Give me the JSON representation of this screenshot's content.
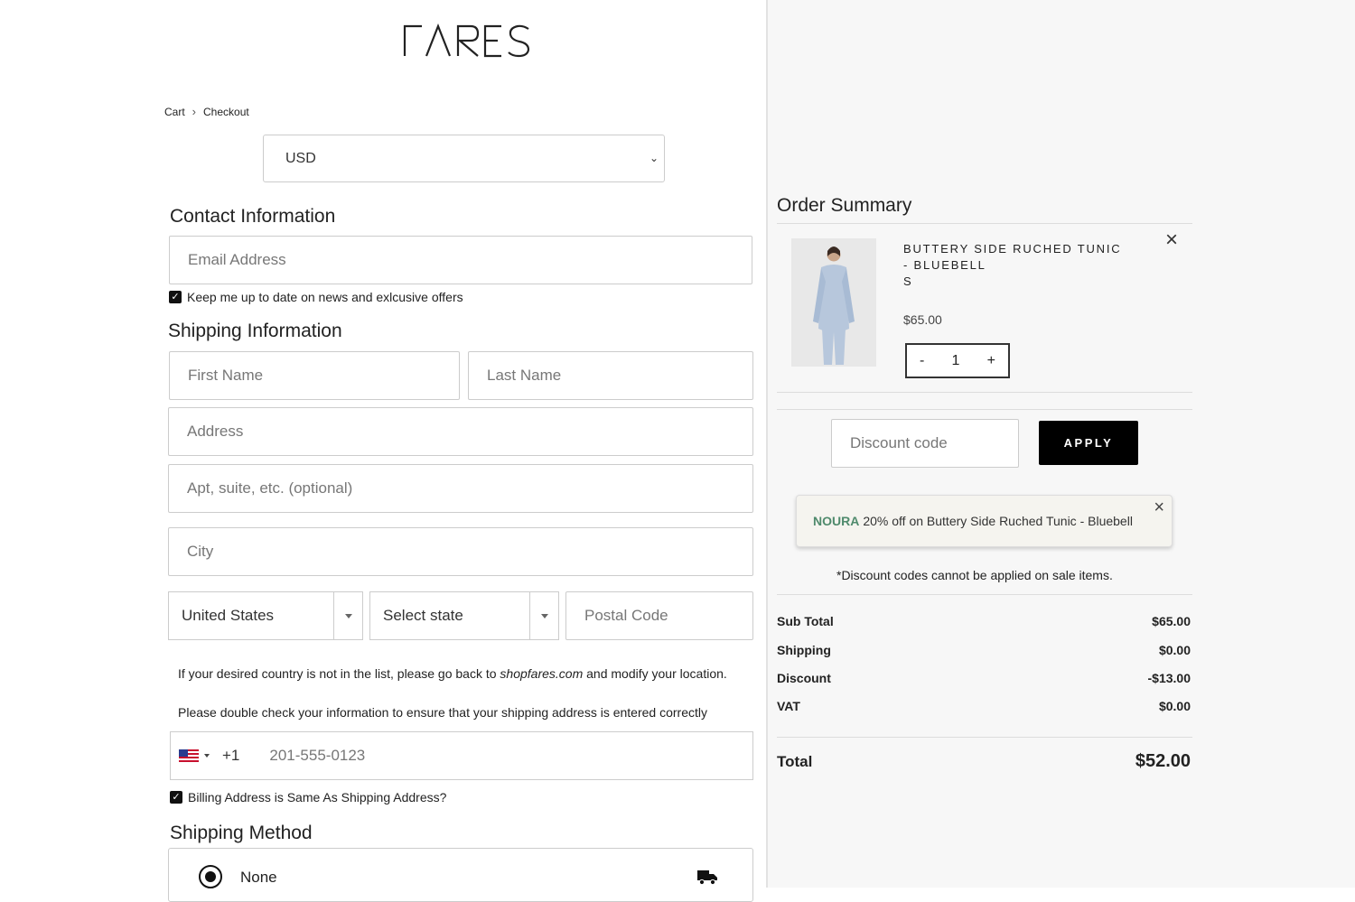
{
  "brand": {
    "logo_text": "FARES"
  },
  "breadcrumb": {
    "cart": "Cart",
    "separator": "›",
    "checkout": "Checkout"
  },
  "currency": {
    "selected": "USD"
  },
  "contact": {
    "title": "Contact Information",
    "email_placeholder": "Email Address",
    "newsletter_label": "Keep me up to date on news and exlcusive offers",
    "newsletter_checked": true
  },
  "shipping": {
    "title": "Shipping Information",
    "first_name_placeholder": "First Name",
    "last_name_placeholder": "Last Name",
    "address_placeholder": "Address",
    "apt_placeholder": "Apt, suite, etc. (optional)",
    "city_placeholder": "City",
    "country_selected": "United States",
    "state_selected": "Select state",
    "postal_placeholder": "Postal Code",
    "country_note_before": "If your desired country is not in the list, please go back to ",
    "country_note_link": "shopfares.com",
    "country_note_after": " and modify your location.",
    "double_check_note": "Please double check your information to ensure that your shipping address is entered correctly",
    "phone_code": "+1",
    "phone_placeholder": "201-555-0123",
    "billing_same_label": "Billing Address is Same As Shipping Address?",
    "billing_same_checked": true
  },
  "shipping_method": {
    "title": "Shipping Method",
    "option_label": "None",
    "icon": "truck-icon"
  },
  "order_summary": {
    "title": "Order Summary",
    "item": {
      "name": "BUTTERY SIDE RUCHED TUNIC - BLUEBELL",
      "size": "S",
      "price": "$65.00",
      "qty_minus": "-",
      "quantity": "1",
      "qty_plus": "+",
      "remove_icon": "×"
    },
    "discount_placeholder": "Discount code",
    "apply_label": "APPLY",
    "promo": {
      "code": "NOURA",
      "description": "20% off on Buttery Side Ruched Tunic - Bluebell",
      "close_icon": "×"
    },
    "discount_note": "*Discount codes cannot be applied on sale items.",
    "rows": [
      {
        "label": "Sub Total",
        "value": "$65.00"
      },
      {
        "label": "Shipping",
        "value": "$0.00"
      },
      {
        "label": "Discount",
        "value": "-$13.00"
      },
      {
        "label": "VAT",
        "value": "$0.00"
      }
    ],
    "total_label": "Total",
    "total_value": "$52.00"
  }
}
